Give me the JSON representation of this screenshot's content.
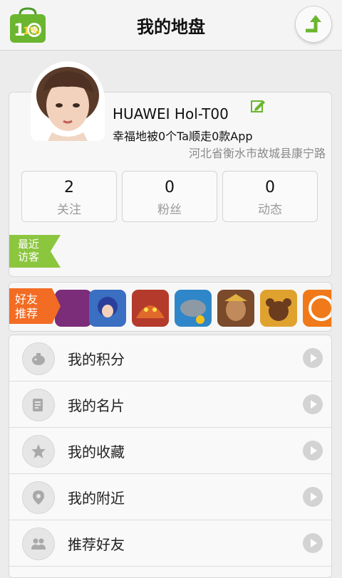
{
  "header": {
    "title": "我的地盘",
    "logo_text": "1%"
  },
  "profile": {
    "username": "HUAWEI Hol-T00",
    "tagline": "幸福地被0个Ta顺走0款App",
    "location": "河北省衡水市故城县康宁路"
  },
  "stats": [
    {
      "value": "2",
      "label": "关注"
    },
    {
      "value": "0",
      "label": "粉丝"
    },
    {
      "value": "0",
      "label": "动态"
    }
  ],
  "recent_visitors_label": "最近访客",
  "friend_recommend_label": "好友推荐",
  "friend_apps": [
    {
      "name": "app-1",
      "color": "#7b2d7a"
    },
    {
      "name": "app-2",
      "color": "#3a6fc2"
    },
    {
      "name": "app-3",
      "color": "#b43a2c"
    },
    {
      "name": "app-4",
      "color": "#2f87c9"
    },
    {
      "name": "app-5",
      "color": "#7a4a2a"
    },
    {
      "name": "app-6",
      "color": "#e0a22f"
    },
    {
      "name": "app-7",
      "color": "#f07a1a"
    }
  ],
  "menu": [
    {
      "label": "我的积分",
      "icon": "piggy-bank-icon"
    },
    {
      "label": "我的名片",
      "icon": "card-icon"
    },
    {
      "label": "我的收藏",
      "icon": "star-icon"
    },
    {
      "label": "我的附近",
      "icon": "location-pin-icon"
    },
    {
      "label": "推荐好友",
      "icon": "friends-icon"
    }
  ],
  "colors": {
    "accent_green": "#8cc63f",
    "accent_orange": "#f26c23"
  }
}
